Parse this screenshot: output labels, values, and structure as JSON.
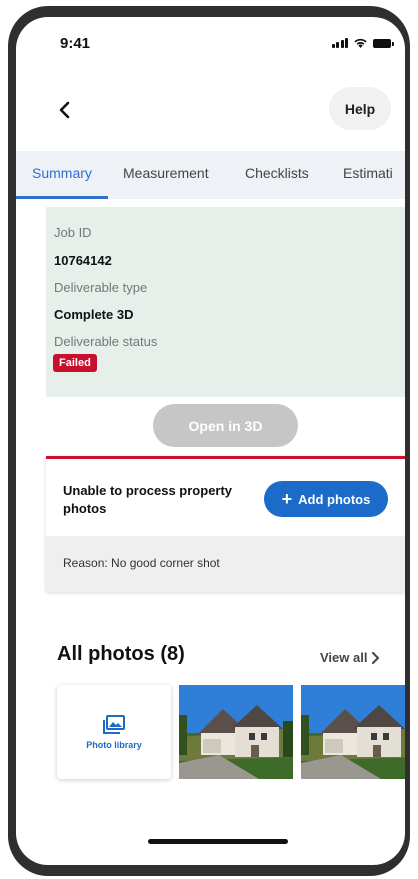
{
  "status_bar": {
    "time": "9:41"
  },
  "header": {
    "help_label": "Help"
  },
  "tabs": [
    {
      "label": "Summary",
      "active": true
    },
    {
      "label": "Measurement",
      "active": false
    },
    {
      "label": "Checklists",
      "active": false
    },
    {
      "label": "Estimati",
      "active": false
    }
  ],
  "summary": {
    "job_id_label": "Job ID",
    "job_id_value": "10764142",
    "deliverable_type_label": "Deliverable type",
    "deliverable_type_value": "Complete 3D",
    "deliverable_status_label": "Deliverable status",
    "deliverable_status_value": "Failed"
  },
  "open_3d_label": "Open in 3D",
  "error_card": {
    "title": "Unable to process property photos",
    "add_photos_label": "Add photos",
    "reason": "Reason: No good corner shot"
  },
  "photos": {
    "title": "All photos (8)",
    "view_all_label": "View all",
    "library_label": "Photo library"
  },
  "colors": {
    "accent_blue": "#1c6bc8",
    "tab_blue": "#2f6fd0",
    "error_red": "#c8102e",
    "summary_bg": "#e6efea"
  }
}
